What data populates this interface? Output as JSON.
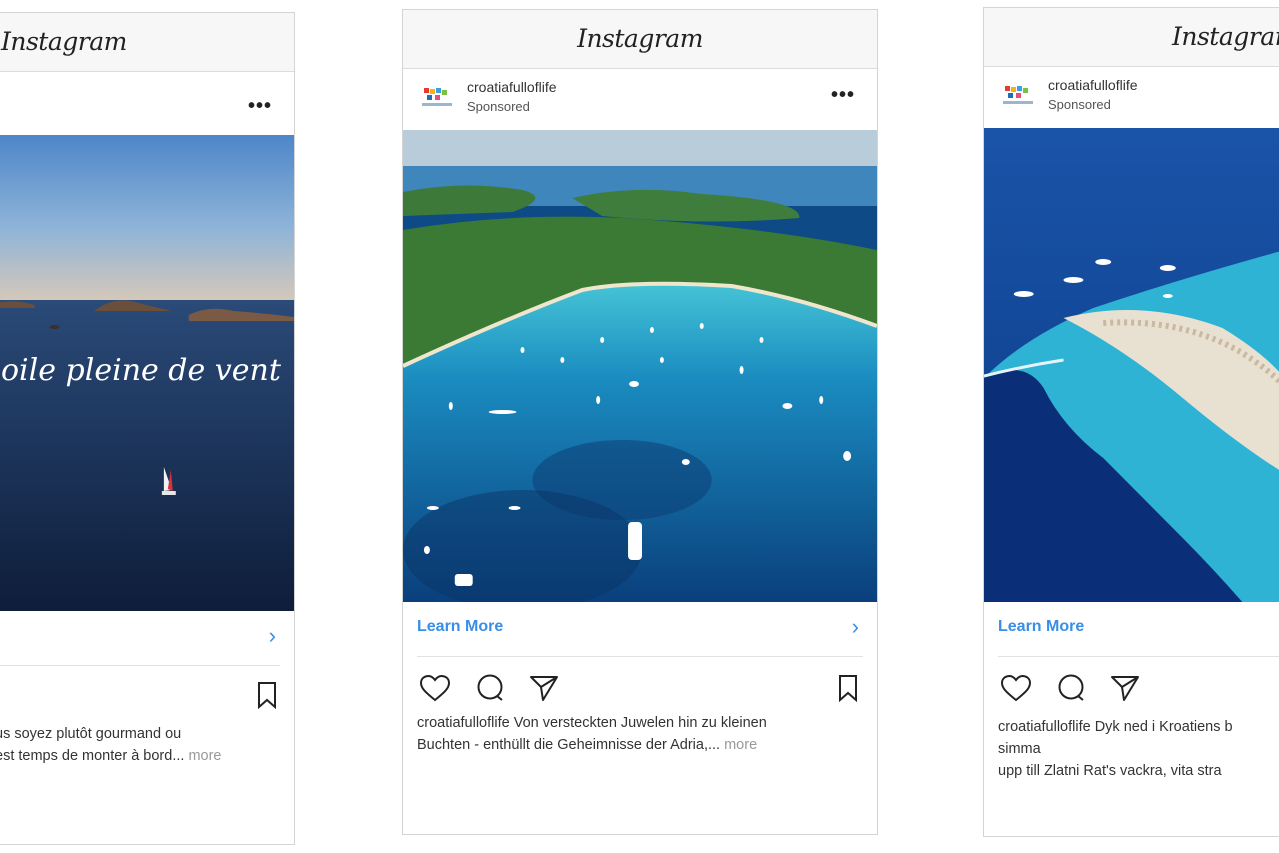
{
  "brand": "Instagram",
  "cards": [
    {
      "account": "",
      "sponsored": "",
      "cta_label": "",
      "caption_lines": [
        "us soyez plutôt gourmand ou",
        "est temps de monter à bord..."
      ],
      "more": "more",
      "overlay_text": "oile pleine de vent"
    },
    {
      "account": "croatiafulloflife",
      "sponsored": "Sponsored",
      "cta_label": "Learn More",
      "caption_lines": [
        "croatiafulloflife Von versteckten Juwelen hin zu kleinen",
        "Buchten - enthüllt die Geheimnisse der Adria,..."
      ],
      "more": "more"
    },
    {
      "account": "croatiafulloflife",
      "sponsored": "Sponsored",
      "cta_label": "Learn More",
      "caption_lines": [
        "croatiafulloflife Dyk ned i Kroatiens b",
        "simma",
        "upp till Zlatni Rat's vackra, vita stra"
      ],
      "more": ""
    }
  ],
  "icons": [
    "ellipsis-icon",
    "chevron-right-icon",
    "heart-icon",
    "comment-icon",
    "share-icon",
    "bookmark-icon"
  ],
  "colors": {
    "cta": "#3a8ee6",
    "sea_deep": "#0d3d78",
    "sea_light": "#2fb8d6"
  }
}
